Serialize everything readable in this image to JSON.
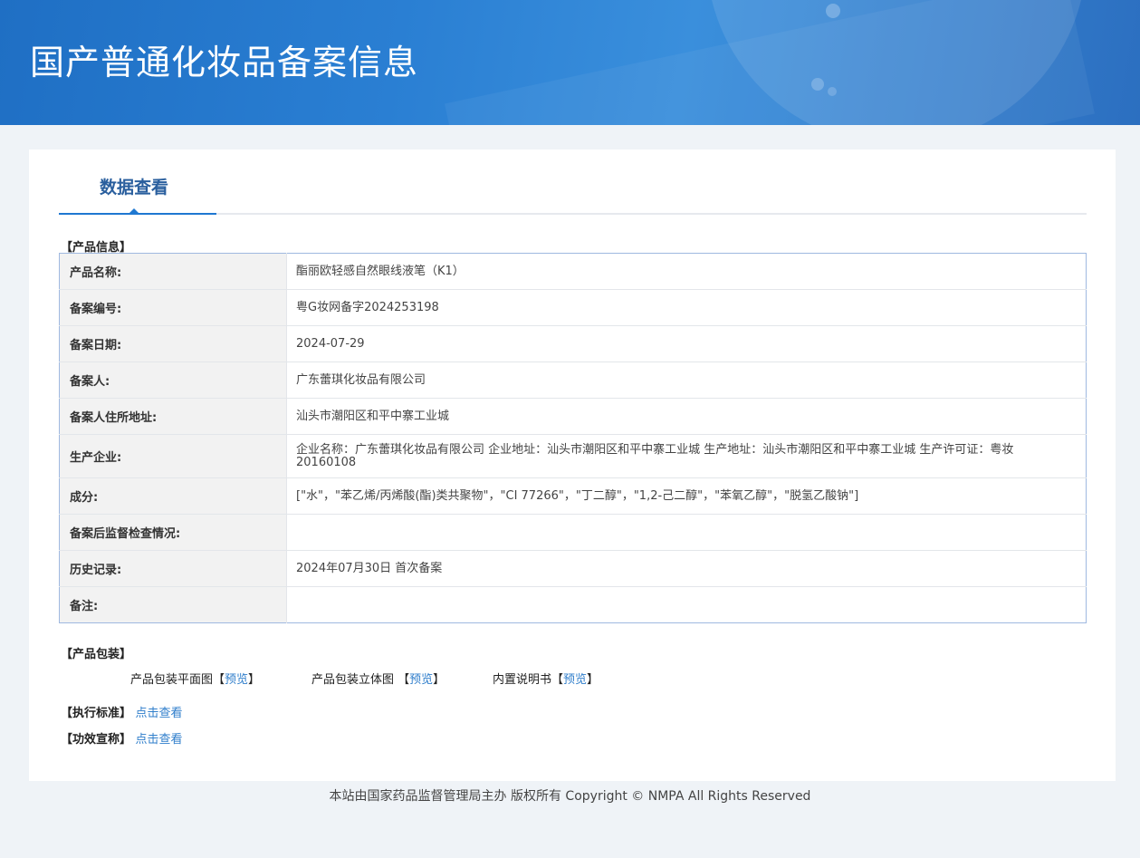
{
  "banner": {
    "title": "国产普通化妆品备案信息"
  },
  "tabs": {
    "active": "数据查看"
  },
  "product_info": {
    "section_label": "【产品信息】",
    "rows": [
      {
        "key": "产品名称:",
        "value": "酯丽欧轻感自然眼线液笔（K1）"
      },
      {
        "key": "备案编号:",
        "value": "粤G妆网备字2024253198"
      },
      {
        "key": "备案日期:",
        "value": "2024-07-29"
      },
      {
        "key": "备案人:",
        "value": "广东蕾琪化妆品有限公司"
      },
      {
        "key": "备案人住所地址:",
        "value": "汕头市潮阳区和平中寨工业城"
      },
      {
        "key": "生产企业:",
        "value": "企业名称：广东蕾琪化妆品有限公司 企业地址：汕头市潮阳区和平中寨工业城 生产地址：汕头市潮阳区和平中寨工业城 生产许可证：粤妆20160108"
      },
      {
        "key": "成分:",
        "value": "[\"水\"，\"苯乙烯/丙烯酸(酯)类共聚物\"，\"CI 77266\"，\"丁二醇\"，\"1,2-己二醇\"，\"苯氧乙醇\"，\"脱氢乙酸钠\"]"
      },
      {
        "key": "备案后监督检查情况:",
        "value": ""
      },
      {
        "key": "历史记录:",
        "value": "2024年07月30日 首次备案"
      },
      {
        "key": "备注:",
        "value": ""
      }
    ]
  },
  "packaging": {
    "section_label": "【产品包装】",
    "items": [
      {
        "label": "产品包装平面图",
        "open": "【",
        "link": "预览",
        "close": "】"
      },
      {
        "label": "产品包装立体图 ",
        "open": "【",
        "link": "预览",
        "close": "】"
      },
      {
        "label": "内置说明书",
        "open": "【",
        "link": "预览",
        "close": "】"
      }
    ]
  },
  "standard": {
    "label": "【执行标准】",
    "link": "点击查看"
  },
  "efficacy": {
    "label": "【功效宣称】",
    "link": "点击查看"
  },
  "footer": {
    "text": "本站由国家药品监督管理局主办 版权所有 Copyright © NMPA All Rights Reserved"
  }
}
